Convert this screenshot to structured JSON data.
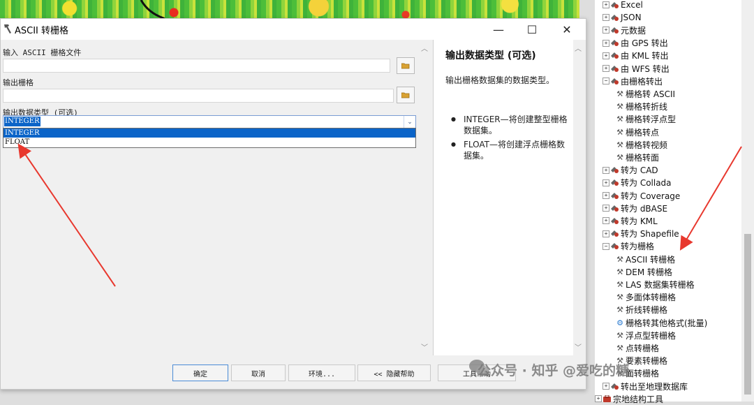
{
  "dialog": {
    "title": "ASCII 转栅格",
    "window_controls": {
      "minimize": "—",
      "maximize": "☐",
      "close": "✕"
    },
    "fields": {
      "input_label": "输入 ASCII 栅格文件",
      "input_value": "",
      "output_label": "输出栅格",
      "output_value": "",
      "type_label": "输出数据类型 (可选)",
      "type_value": "INTEGER",
      "type_options": [
        "INTEGER",
        "FLOAT"
      ]
    },
    "help": {
      "title": "输出数据类型 (可选)",
      "description": "输出栅格数据集的数据类型。",
      "bullets": [
        "INTEGER—将创建整型栅格数据集。",
        "FLOAT—将创建浮点栅格数据集。"
      ]
    },
    "buttons": {
      "ok": "确定",
      "cancel": "取消",
      "env": "环境...",
      "hide_help": "<< 隐藏帮助",
      "tool_help": "工具帮助"
    }
  },
  "toolbox": {
    "items": [
      {
        "label": "Excel",
        "kind": "toolset",
        "expander": "+"
      },
      {
        "label": "JSON",
        "kind": "toolset",
        "expander": "+"
      },
      {
        "label": "元数据",
        "kind": "toolset",
        "expander": "+"
      },
      {
        "label": "由 GPS 转出",
        "kind": "toolset",
        "expander": "+"
      },
      {
        "label": "由 KML 转出",
        "kind": "toolset",
        "expander": "+"
      },
      {
        "label": "由 WFS 转出",
        "kind": "toolset",
        "expander": "+"
      },
      {
        "label": "由栅格转出",
        "kind": "toolset",
        "expander": "−"
      },
      {
        "label": "栅格转 ASCII",
        "kind": "tool"
      },
      {
        "label": "栅格转折线",
        "kind": "tool"
      },
      {
        "label": "栅格转浮点型",
        "kind": "tool"
      },
      {
        "label": "栅格转点",
        "kind": "tool"
      },
      {
        "label": "栅格转视频",
        "kind": "tool"
      },
      {
        "label": "栅格转面",
        "kind": "tool"
      },
      {
        "label": "转为 CAD",
        "kind": "toolset",
        "expander": "+"
      },
      {
        "label": "转为 Collada",
        "kind": "toolset",
        "expander": "+"
      },
      {
        "label": "转为 Coverage",
        "kind": "toolset",
        "expander": "+"
      },
      {
        "label": "转为 dBASE",
        "kind": "toolset",
        "expander": "+"
      },
      {
        "label": "转为 KML",
        "kind": "toolset",
        "expander": "+"
      },
      {
        "label": "转为 Shapefile",
        "kind": "toolset",
        "expander": "+"
      },
      {
        "label": "转为栅格",
        "kind": "toolset",
        "expander": "−"
      },
      {
        "label": "ASCII 转栅格",
        "kind": "tool"
      },
      {
        "label": "DEM 转栅格",
        "kind": "tool"
      },
      {
        "label": "LAS 数据集转栅格",
        "kind": "tool"
      },
      {
        "label": "多面体转栅格",
        "kind": "tool"
      },
      {
        "label": "折线转栅格",
        "kind": "tool"
      },
      {
        "label": "栅格转其他格式(批量)",
        "kind": "script"
      },
      {
        "label": "浮点型转栅格",
        "kind": "tool"
      },
      {
        "label": "点转栅格",
        "kind": "tool"
      },
      {
        "label": "要素转栅格",
        "kind": "tool"
      },
      {
        "label": "面转栅格",
        "kind": "tool"
      },
      {
        "label": "转出至地理数据库",
        "kind": "toolset",
        "expander": "+"
      },
      {
        "label": "宗地结构工具",
        "kind": "toolbox",
        "expander": "+"
      }
    ]
  },
  "watermark": {
    "text": "公众号 · 知乎 @爱吃的糖"
  },
  "colors": {
    "annotation_arrow": "#e8382e",
    "selection": "#0b64c8"
  }
}
